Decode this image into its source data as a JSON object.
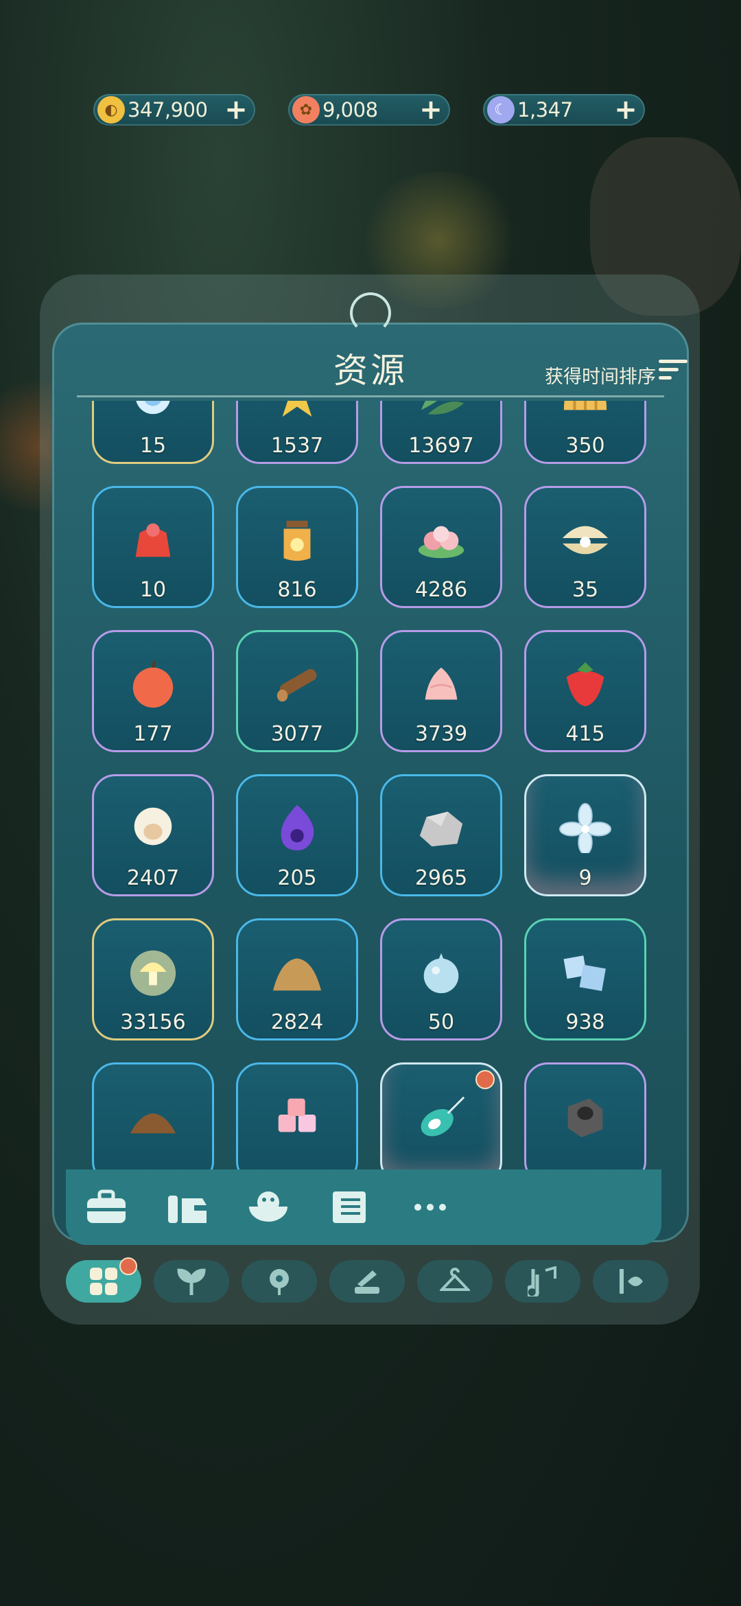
{
  "currencies": [
    {
      "name": "gold-coin",
      "value": "347,900",
      "color": "#f0c040"
    },
    {
      "name": "flower-token",
      "value": "9,008",
      "color": "#f08060"
    },
    {
      "name": "moon-token",
      "value": "1,347",
      "color": "#a0a8f0"
    }
  ],
  "panel": {
    "title": "资源",
    "sort_label": "获得时间排序"
  },
  "items": [
    {
      "icon": "sparkle-orb",
      "count": "15",
      "border": "gold"
    },
    {
      "icon": "star",
      "count": "1537",
      "border": "purple"
    },
    {
      "icon": "leaves",
      "count": "13697",
      "border": "purple"
    },
    {
      "icon": "shell",
      "count": "350",
      "border": "purple"
    },
    {
      "icon": "jelly",
      "count": "10",
      "border": "blue"
    },
    {
      "icon": "firefly-jar",
      "count": "816",
      "border": "blue"
    },
    {
      "icon": "sweet-dumpling",
      "count": "4286",
      "border": "purple"
    },
    {
      "icon": "pearl-clam",
      "count": "35",
      "border": "purple"
    },
    {
      "icon": "apple",
      "count": "177",
      "border": "purple"
    },
    {
      "icon": "wood-log",
      "count": "3077",
      "border": "green"
    },
    {
      "icon": "cream",
      "count": "3739",
      "border": "purple"
    },
    {
      "icon": "strawberry",
      "count": "415",
      "border": "purple"
    },
    {
      "icon": "wool-sheep",
      "count": "2407",
      "border": "purple"
    },
    {
      "icon": "purple-flame",
      "count": "205",
      "border": "blue"
    },
    {
      "icon": "stone",
      "count": "2965",
      "border": "blue"
    },
    {
      "icon": "crystal-flower",
      "count": "9",
      "border": "rare"
    },
    {
      "icon": "glowing-mushroom",
      "count": "33156",
      "border": "gold"
    },
    {
      "icon": "sand-pile",
      "count": "2824",
      "border": "blue"
    },
    {
      "icon": "water-drop",
      "count": "50",
      "border": "purple"
    },
    {
      "icon": "ice-cubes",
      "count": "938",
      "border": "green"
    },
    {
      "icon": "soil-pile",
      "count": "",
      "border": "blue"
    },
    {
      "icon": "candy-cubes",
      "count": "",
      "border": "blue"
    },
    {
      "icon": "peacock-feather",
      "count": "",
      "border": "rare",
      "badge": true
    },
    {
      "icon": "metal-pipe",
      "count": "",
      "border": "purple"
    }
  ],
  "categories": [
    "toolbox-icon",
    "pet-icon",
    "food-bowl-icon",
    "book-icon",
    "more-icon"
  ],
  "nav": [
    "grid-icon",
    "sprout-icon",
    "flower-icon",
    "craft-icon",
    "hanger-icon",
    "music-icon",
    "fish-icon"
  ]
}
